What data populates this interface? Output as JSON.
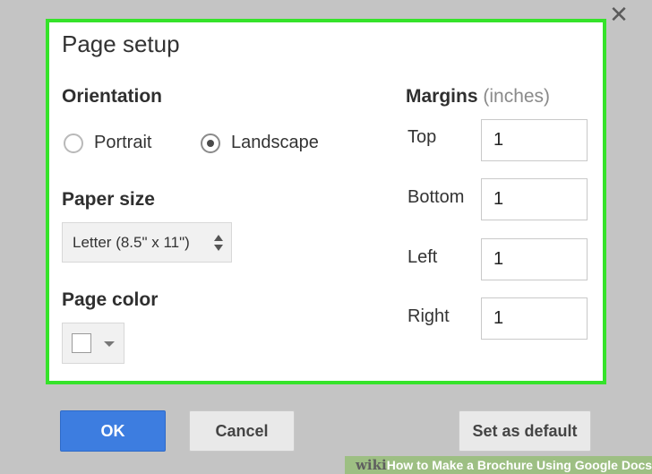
{
  "dialog": {
    "title": "Page setup",
    "close_icon": "close-icon"
  },
  "orientation": {
    "label": "Orientation",
    "options": [
      {
        "label": "Portrait",
        "selected": false
      },
      {
        "label": "Landscape",
        "selected": true
      }
    ]
  },
  "paper_size": {
    "label": "Paper size",
    "value": "Letter (8.5\" x 11\")"
  },
  "page_color": {
    "label": "Page color",
    "value": "#ffffff"
  },
  "margins": {
    "label": "Margins",
    "unit": "(inches)",
    "fields": [
      {
        "label": "Top",
        "value": "1"
      },
      {
        "label": "Bottom",
        "value": "1"
      },
      {
        "label": "Left",
        "value": "1"
      },
      {
        "label": "Right",
        "value": "1"
      }
    ]
  },
  "buttons": {
    "ok": "OK",
    "cancel": "Cancel",
    "set_default": "Set as default"
  },
  "watermark": {
    "brand": "wiki",
    "text": "How to Make a Brochure Using Google Docs"
  },
  "colors": {
    "highlight": "#35e32a",
    "primary": "#3d7de0",
    "overlay": "#c4c4c4"
  }
}
